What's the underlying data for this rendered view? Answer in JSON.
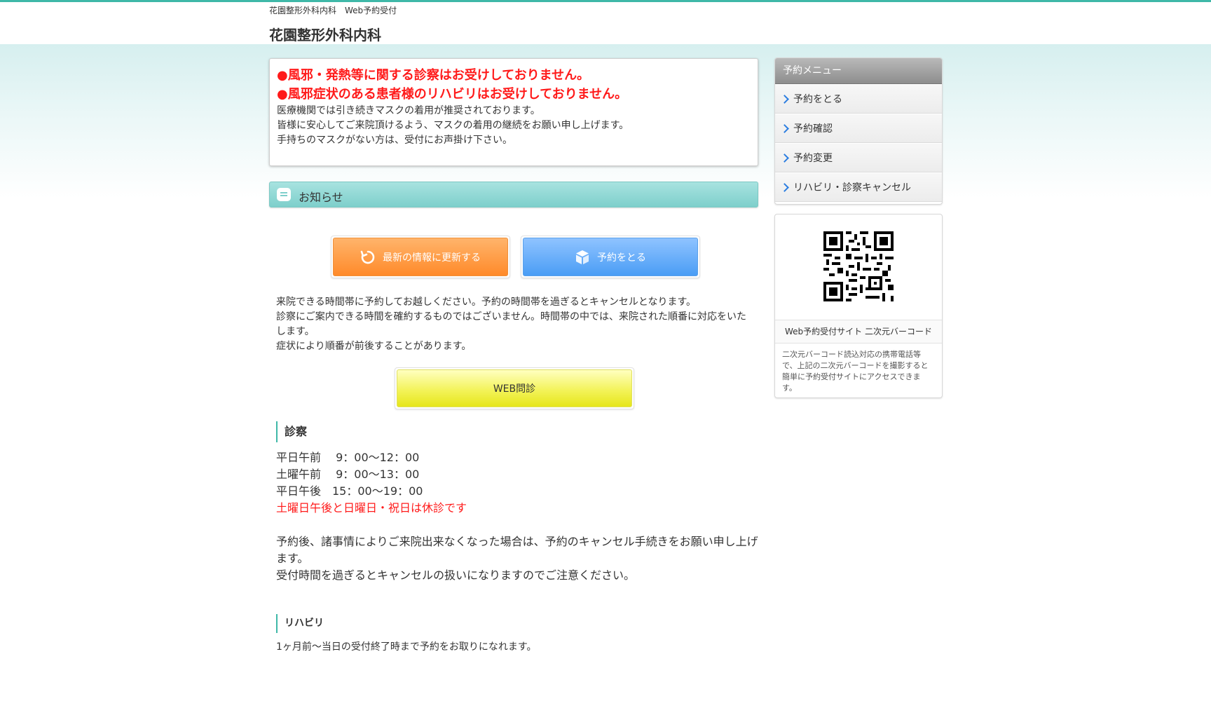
{
  "header": {
    "breadcrumb": "花園整形外科内科　Web予約受付",
    "site_title": "花園整形外科内科"
  },
  "notice": {
    "alert1": "●風邪・発熱等に関する診察はお受けしておりません。",
    "alert2": "●風邪症状のある患者様のリハビリはお受けしておりません。",
    "line1": "医療機関では引き続きマスクの着用が推奨されております。",
    "line2": "皆様に安心してご来院頂けるよう、マスクの着用の継続をお願い申し上げます。",
    "line3": "手持ちのマスクがない方は、受付にお声掛け下さい。"
  },
  "oshirase": {
    "label": "お知らせ",
    "icon": "chat-bubble-icon"
  },
  "buttons": {
    "refresh": {
      "label": "最新の情報に更新する",
      "icon": "refresh-icon",
      "color": "#ff8a2a"
    },
    "reserve": {
      "label": "予約をとる",
      "icon": "cube-icon",
      "color": "#4a9df5"
    },
    "web_monshin": {
      "label": "WEB問診",
      "color": "#e6e61a"
    }
  },
  "intro": {
    "line1": "来院できる時間帯に予約してお越しください。予約の時間帯を過ぎるとキャンセルとなります。",
    "line2": "診察にご案内できる時間を確約するものではございません。時間帯の中では、来院された順番に対応をいたします。",
    "line3": "症状により順番が前後することがあります。"
  },
  "shinsatsu": {
    "heading": "診察",
    "h1": "平日午前　 9：00～12：00",
    "h2": "土曜午前　 9：00～13：00",
    "h3": "平日午後　15：00～19：00",
    "closed": "土曜日午後と日曜日・祝日は休診です",
    "cancel1": "予約後、諸事情によりご来院出来なくなった場合は、予約のキャンセル手続きをお願い申し上げます。",
    "cancel2": "受付時間を過ぎるとキャンセルの扱いになりますのでご注意ください。"
  },
  "rehab": {
    "heading": "リハビリ",
    "text": "1ヶ月前～当日の受付終了時まで予約をお取りになれます。"
  },
  "sidebar": {
    "menu_title": "予約メニュー",
    "items": [
      {
        "label": "予約をとる"
      },
      {
        "label": "予約確認"
      },
      {
        "label": "予約変更"
      },
      {
        "label": "リハビリ・診察キャンセル"
      }
    ],
    "qr_caption": "Web予約受付サイト 二次元バーコード",
    "qr_desc": "二次元バーコード読込対応の携帯電話等で、上記の二次元バーコードを撮影すると簡単に予約受付サイトにアクセスできます。"
  },
  "colors": {
    "accent": "#3fb8a8",
    "alert": "#ff1a1a",
    "link_chevron": "#2b7de0"
  }
}
